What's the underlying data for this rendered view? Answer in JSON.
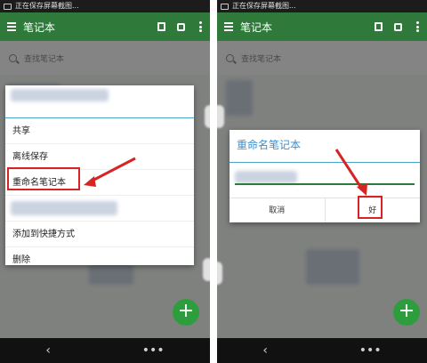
{
  "status_bar": {
    "text": "正在保存屏幕截图..."
  },
  "app_bar": {
    "title": "笔记本"
  },
  "search": {
    "placeholder": "查找笔记本"
  },
  "context_menu": {
    "items": [
      {
        "label": "共享"
      },
      {
        "label": "离线保存"
      },
      {
        "label": "重命名笔记本"
      },
      {
        "label": ""
      },
      {
        "label": "添加到快捷方式"
      },
      {
        "label": "删除"
      }
    ]
  },
  "rename_dialog": {
    "title": "重命名笔记本",
    "cancel_label": "取消",
    "ok_label": "好"
  },
  "fab": {
    "label": "+"
  },
  "nav": {
    "back_glyph": "‹",
    "more_glyph": "•••"
  },
  "colors": {
    "app_bar": "#2f7a3b",
    "fab": "#2e9d3e",
    "accent_blue": "#4aa3c9",
    "highlight_red": "#d62424"
  }
}
